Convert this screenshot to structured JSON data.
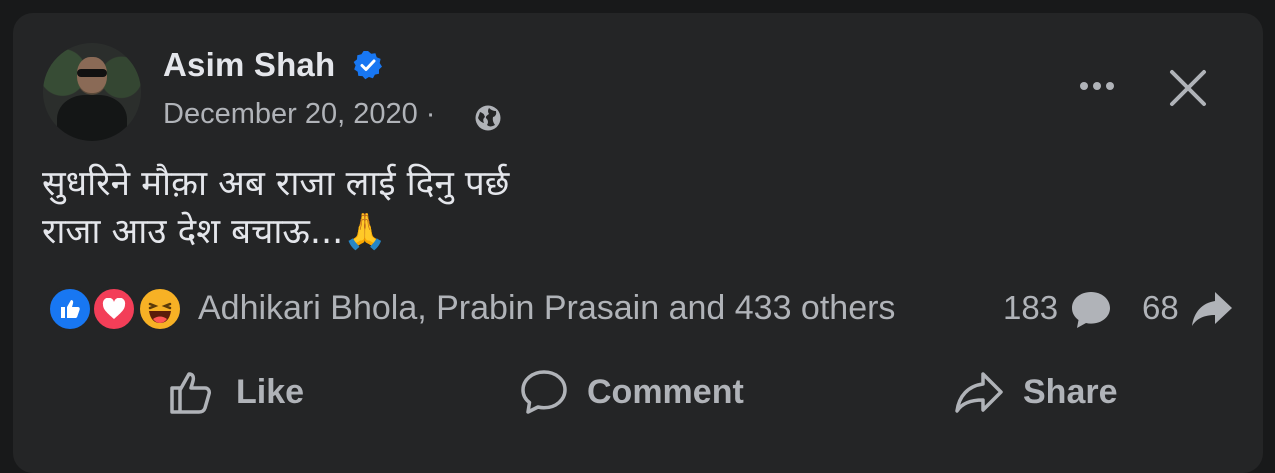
{
  "post": {
    "author": "Asim Shah",
    "date": "December 20, 2020 ·",
    "text_line1": "सुधरिने मौक़ा अब राजा लाई दिनु पर्छ",
    "text_line2": "राजा आउ देश बचाऊ...",
    "emoji": "🙏"
  },
  "stats": {
    "reaction_names": "Adhikari Bhola, Prabin Prasain and 433 others",
    "comments": "183",
    "shares": "68"
  },
  "actions": {
    "like": "Like",
    "comment": "Comment",
    "share": "Share"
  },
  "icons": [
    "verified-badge-icon",
    "globe-icon",
    "more-icon",
    "close-icon",
    "like-reaction-icon",
    "love-reaction-icon",
    "haha-reaction-icon",
    "comment-icon",
    "share-icon",
    "thumbs-up-icon"
  ],
  "colors": {
    "background": "#18191a",
    "card": "#242526",
    "text": "#e4e6eb",
    "secondary": "#b0b3b8",
    "verified": "#1877f2"
  }
}
